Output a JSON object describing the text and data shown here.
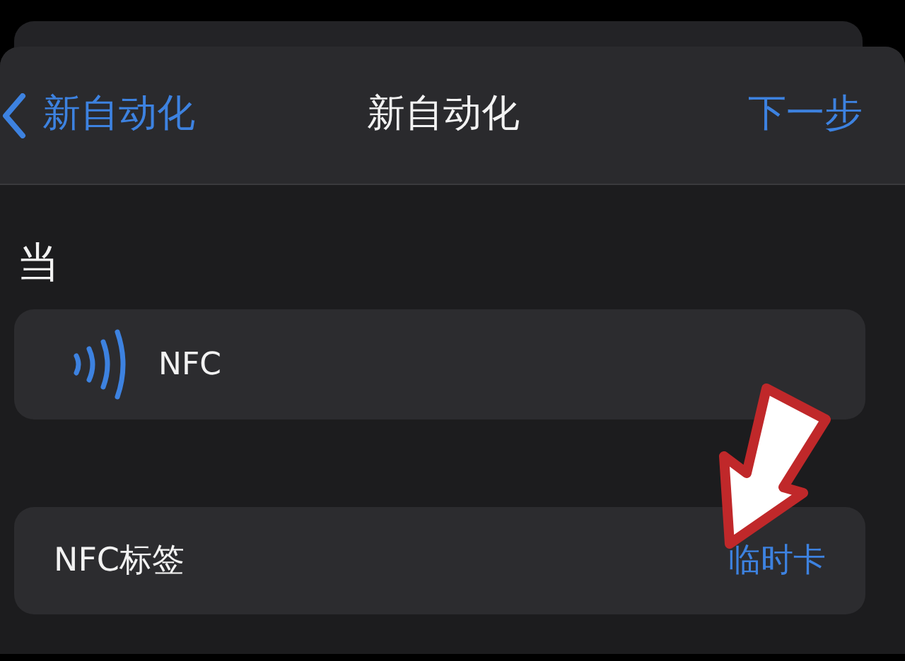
{
  "nav_bar": {
    "back_label": "新自动化",
    "title": "新自动化",
    "next_label": "下一步"
  },
  "section_header": "当",
  "trigger": {
    "label": "NFC"
  },
  "settings": [
    {
      "kind": "value",
      "label": "NFC标签",
      "value": "临时卡"
    }
  ],
  "annotation": {
    "kind": "arrow"
  }
}
